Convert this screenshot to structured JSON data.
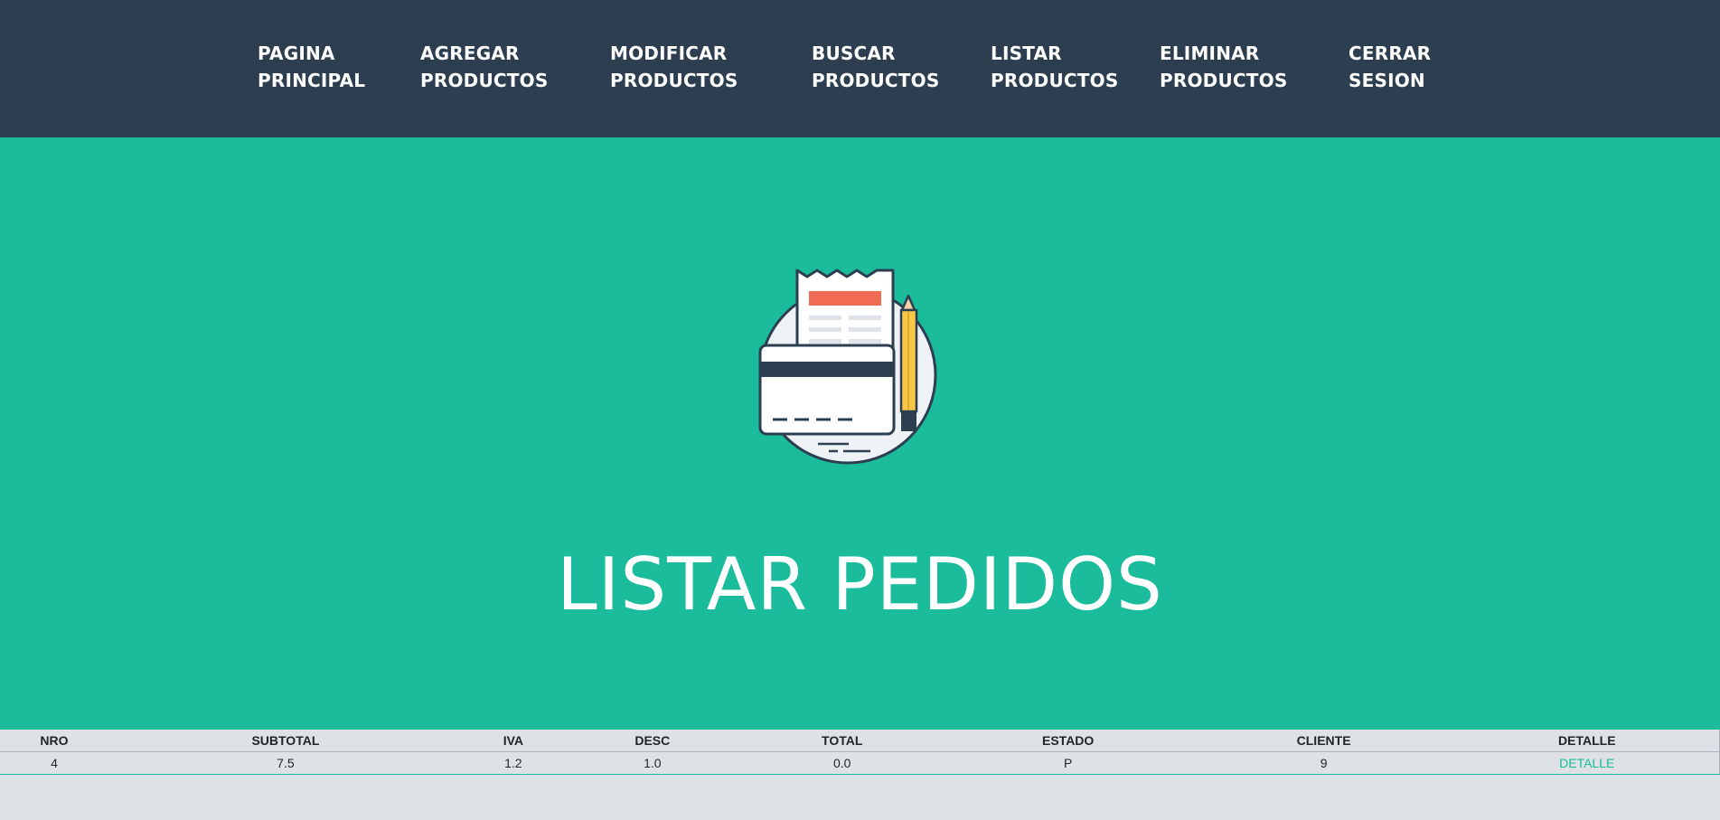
{
  "nav": {
    "items": [
      {
        "line1": "PAGINA",
        "line2": "PRINCIPAL"
      },
      {
        "line1": "AGREGAR",
        "line2": "PRODUCTOS"
      },
      {
        "line1": "MODIFICAR",
        "line2": "PRODUCTOS"
      },
      {
        "line1": "BUSCAR",
        "line2": "PRODUCTOS"
      },
      {
        "line1": "LISTAR",
        "line2": "PRODUCTOS"
      },
      {
        "line1": "ELIMINAR",
        "line2": "PRODUCTOS"
      },
      {
        "line1": "CERRAR",
        "line2": "SESION"
      }
    ]
  },
  "hero": {
    "icon": "receipt-card-pencil-icon",
    "title": "LISTAR PEDIDOS"
  },
  "table": {
    "headers": [
      "NRO",
      "SUBTOTAL",
      "IVA",
      "DESC",
      "TOTAL",
      "ESTADO",
      "CLIENTE",
      "DETALLE"
    ],
    "rows": [
      {
        "nro": "4",
        "subtotal": "7.5",
        "iva": "1.2",
        "desc": "1.0",
        "total": "0.0",
        "estado": "P",
        "cliente": "9",
        "detalle": "DETALLE"
      }
    ]
  },
  "colors": {
    "navbar": "#2c3e50",
    "hero": "#1abc9c",
    "page_bg": "#dee2e6",
    "link": "#18bc9c"
  }
}
